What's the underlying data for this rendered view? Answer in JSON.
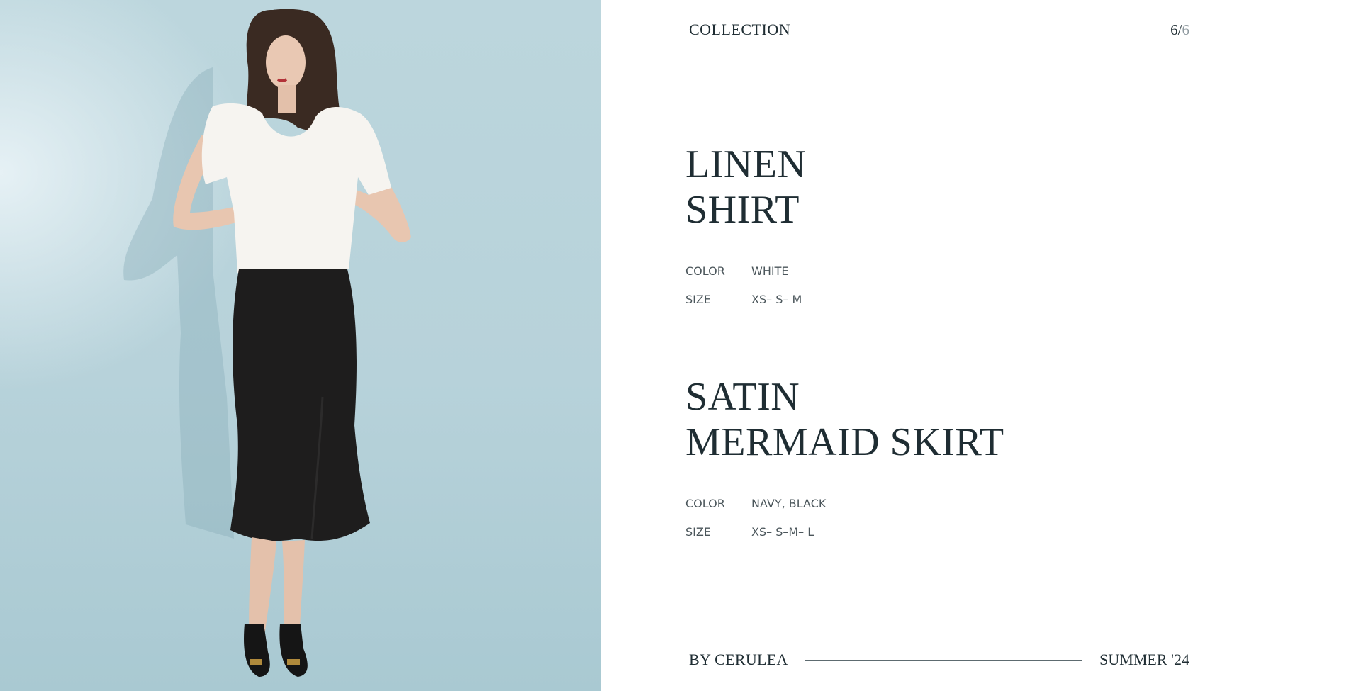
{
  "header": {
    "label": "COLLECTION",
    "page_current": "6/",
    "page_total": "6"
  },
  "products": [
    {
      "name_line1": "LINEN",
      "name_line2": "SHIRT",
      "color_label": "COLOR",
      "color_value": "WHITE",
      "size_label": "SIZE",
      "size_value": "XS– S– M"
    },
    {
      "name_line1": "SATIN",
      "name_line2": "MERMAID SKIRT",
      "color_label": "COLOR",
      "color_value": "NAVY, BLACK",
      "size_label": "SIZE",
      "size_value": "XS– S–M– L"
    }
  ],
  "footer": {
    "brand": "BY CERULEA",
    "season": "SUMMER '24"
  },
  "colors": {
    "background_photo": "#b7d2da",
    "text_dark": "#1f2d33",
    "rule": "#5d6b70"
  }
}
